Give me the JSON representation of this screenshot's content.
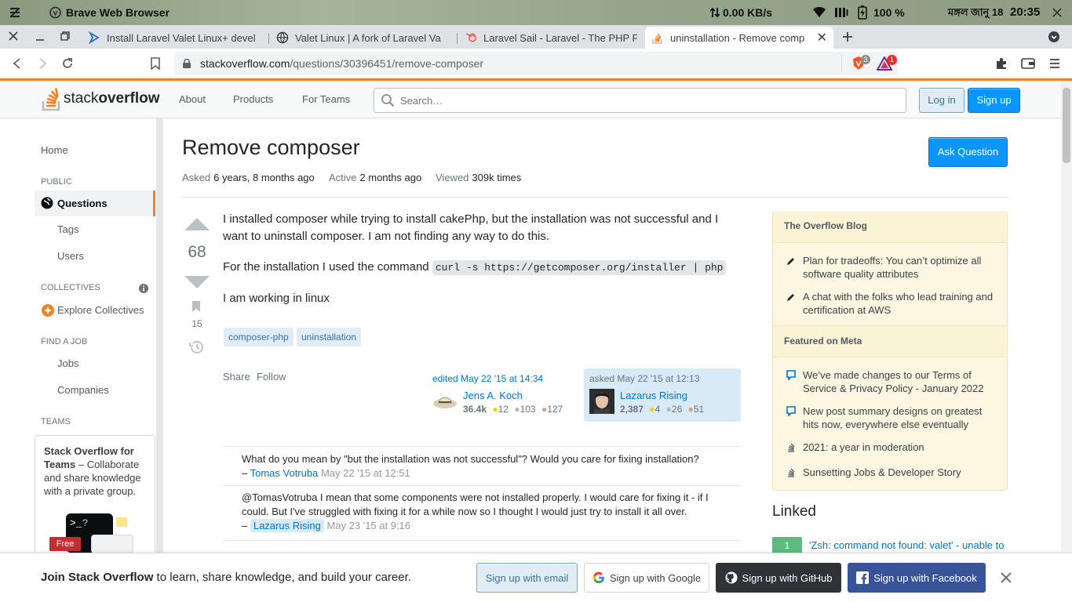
{
  "system": {
    "browser_name": "Brave Web Browser",
    "net_speed": "0.00 KB/s",
    "battery": "100 %",
    "date": "মঙ্গল জানু 18",
    "time": "20:35"
  },
  "tabs": [
    {
      "label": "Install Laravel Valet Linux+ devel",
      "icon": "valet-arrow-icon",
      "active": false
    },
    {
      "label": "Valet Linux | A fork of Laravel Va",
      "icon": "globe-icon",
      "active": false
    },
    {
      "label": "Laravel Sail - Laravel - The PHP F",
      "icon": "laravel-icon",
      "active": false
    },
    {
      "label": "uninstallation - Remove comp",
      "icon": "stackoverflow-icon",
      "active": true
    }
  ],
  "address": {
    "host": "stackoverflow.com",
    "path": "/questions/30396451/remove-composer",
    "brave_shields_count": "3",
    "rewards_count": "1"
  },
  "header": {
    "logo_text_light": "stack",
    "logo_text_bold": "overflow",
    "nav": [
      "About",
      "Products",
      "For Teams"
    ],
    "search_placeholder": "Search…",
    "login": "Log in",
    "signup": "Sign up"
  },
  "sidebar": {
    "home": "Home",
    "public_caption": "PUBLIC",
    "questions": "Questions",
    "tags": "Tags",
    "users": "Users",
    "collectives_caption": "COLLECTIVES",
    "explore_collectives": "Explore Collectives",
    "find_job_caption": "FIND A JOB",
    "jobs": "Jobs",
    "companies": "Companies",
    "teams_caption": "TEAMS",
    "teams_title": "Stack Overflow for Teams",
    "teams_desc": " – Collaborate and share knowledge with a private group.",
    "free_badge": "Free"
  },
  "question": {
    "title": "Remove composer",
    "ask_button": "Ask Question",
    "asked_label": "Asked",
    "asked_value": "6 years, 8 months ago",
    "active_label": "Active",
    "active_value": "2 months ago",
    "viewed_label": "Viewed",
    "viewed_value": "309k times",
    "votes": "68",
    "bookmarks": "15",
    "p1": "I installed composer while trying to install cakePhp, but the installation was not successful and I want to uninstall composer. I am not finding any way to do this.",
    "p2_prefix": "For the installation I used the command ",
    "p2_code": "curl -s https://getcomposer.org/installer | php",
    "p3": "I am working in linux",
    "tags": [
      "composer-php",
      "uninstallation"
    ],
    "share": "Share",
    "follow": "Follow",
    "editor": {
      "action": "edited May 22 '15 at 14:34",
      "name": "Jens A. Koch",
      "rep": "36.4k",
      "gold": "12",
      "silver": "103",
      "bronze": "127"
    },
    "owner": {
      "action": "asked May 22 '15 at 12:13",
      "name": "Lazarus Rising",
      "rep": "2,387",
      "gold": "4",
      "silver": "26",
      "bronze": "51"
    }
  },
  "comments": [
    {
      "text": "What do you mean by \"but the installation was not successful\"? Would you care for fixing installation?",
      "dash": "– ",
      "user": "Tomas Votruba",
      "date": "May 22 '15 at 12:51"
    },
    {
      "text": "@TomasVotruba I mean that some components were not installed properly. I would care for fixing it - if I could. But I've struggled with fixing it for a while now so I thought I would just try to install it all over.",
      "dash": "– ",
      "user": "Lazarus Rising",
      "date": "May 23 '15 at 9:16"
    }
  ],
  "blog": {
    "overflow_title": "The Overflow Blog",
    "overflow_items": [
      "Plan for tradeoffs: You can’t optimize all software quality attributes",
      "A chat with the folks who lead training and certification at AWS"
    ],
    "meta_title": "Featured on Meta",
    "meta_items": [
      "We’ve made changes to our Terms of Service & Privacy Policy - January 2022",
      "New post summary designs on greatest hits now, everywhere else eventually",
      "2021: a year in moderation",
      "Sunsetting Jobs & Developer Story"
    ]
  },
  "linked": {
    "title": "Linked",
    "items": [
      {
        "count": "1",
        "text": "'Zsh: command not found: valet' - unable to"
      }
    ]
  },
  "signup_bar": {
    "bold": "Join Stack Overflow",
    "rest": " to learn, share knowledge, and build your career.",
    "email": "Sign up with email",
    "google": "Sign up with Google",
    "github": "Sign up with GitHub",
    "facebook": "Sign up with Facebook"
  },
  "colors": {
    "so_orange": "#f48024",
    "link_blue": "#0074cc",
    "button_blue": "#0a95ff",
    "tag_bg": "#e1ecf4",
    "blog_bg": "#fdf7e2"
  }
}
